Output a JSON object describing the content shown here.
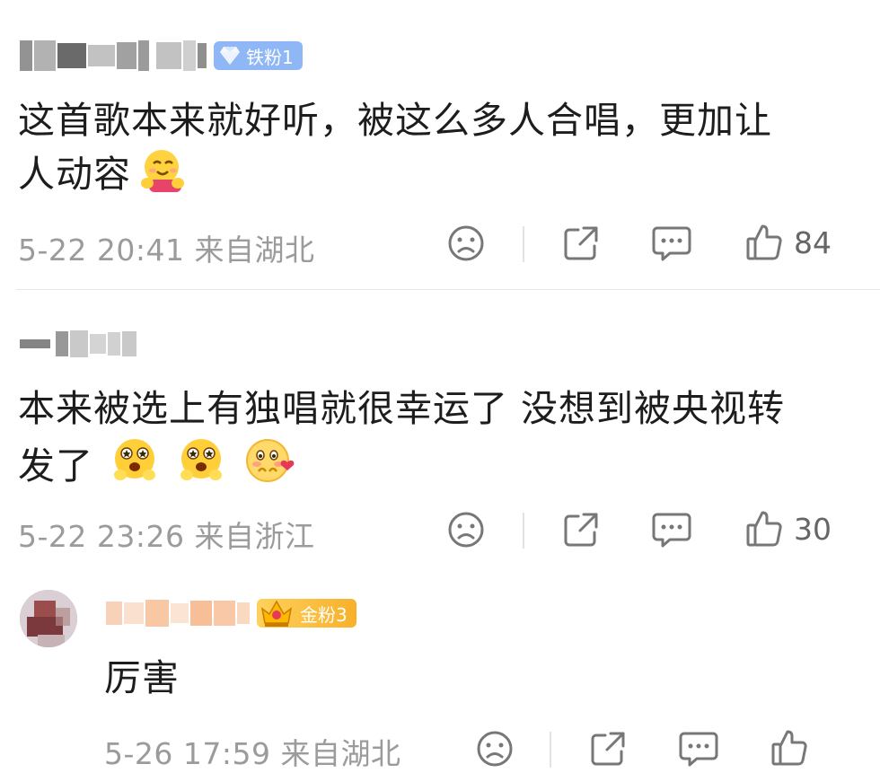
{
  "comments": [
    {
      "username": "",
      "badge": {
        "label": "铁粉1",
        "icon": "diamond-icon",
        "color": "#8fb6f5"
      },
      "text_line1": "这首歌本来就好听，被这么多人合唱，更加让",
      "text_line2": "人动容",
      "emojis": [
        "hug-emoji"
      ],
      "date": "5-22",
      "time": "20:41",
      "location": "来自湖北",
      "likes": "84"
    },
    {
      "username": "",
      "text_line1": "本来被选上有独唱就很幸运了 没想到被央视转",
      "text_line2": "发了",
      "emojis": [
        "excited-emoji",
        "excited-emoji",
        "shy-love-emoji"
      ],
      "date": "5-22",
      "time": "23:26",
      "location": "来自浙江",
      "likes": "30"
    },
    {
      "username": "",
      "badge": {
        "label": "金粉3",
        "icon": "crown-icon",
        "color": "#f8b02a"
      },
      "text_line1": "厉害",
      "date": "5-26",
      "time": "17:59",
      "location": "来自湖北"
    }
  ],
  "icons": {
    "dislike": "sad-face-icon",
    "share": "share-icon",
    "reply": "comment-icon",
    "like": "thumbs-up-icon"
  }
}
